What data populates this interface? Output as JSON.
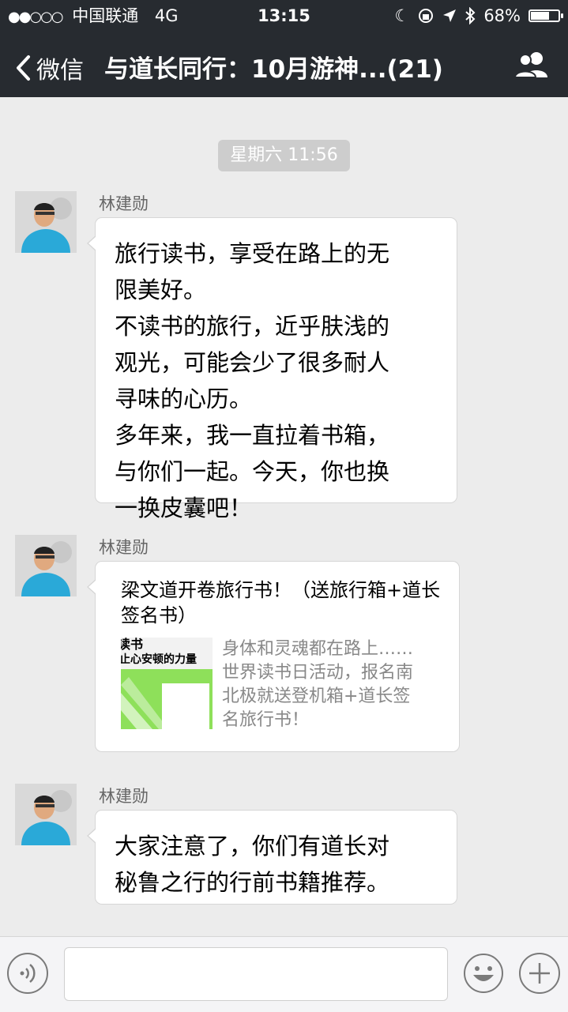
{
  "status_bar": {
    "carrier": "中国联通",
    "network": "4G",
    "time": "13:15",
    "battery": "68%",
    "battery_level": 0.68
  },
  "nav": {
    "back_label": "微信",
    "title": "与道长同行：10月游神...(21)"
  },
  "timestamp": "星期六 11:56",
  "messages": [
    {
      "sender": "林建勋",
      "text": "旅行读书，享受在路上的无\n限美好。\n不读书的旅行，近乎肤浅的\n观光，可能会少了很多耐人\n寻味的心历。\n多年来，我一直拉着书箱，\n与你们一起。今天，你也换\n一换皮囊吧！"
    },
    {
      "sender": "林建勋",
      "card": {
        "title": "梁文道开卷旅行书！（送旅行箱+道长签名书）",
        "thumb_top": "读书",
        "thumb_sub": "止心安顿的力量",
        "description": "身体和灵魂都在路上……\n世界读书日活动，报名南\n北极就送登机箱+道长签\n名旅行书！"
      }
    },
    {
      "sender": "林建勋",
      "text": "大家注意了，你们有道长对\n秘鲁之行的行前书籍推荐。"
    }
  ],
  "colors": {
    "nav_background": "#272b30",
    "chat_background": "#ececec",
    "bubble": "#ffffff"
  }
}
